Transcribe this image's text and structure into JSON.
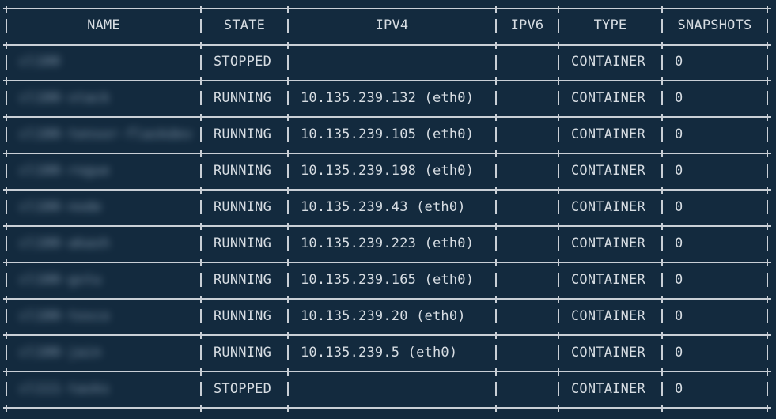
{
  "columns": [
    "NAME",
    "STATE",
    "IPV4",
    "IPV6",
    "TYPE",
    "SNAPSHOTS"
  ],
  "rows": [
    {
      "name": "cl100",
      "state": "STOPPED",
      "ipv4": "",
      "ipv6": "",
      "type": "CONTAINER",
      "snapshots": "0"
    },
    {
      "name": "cl100-stack",
      "state": "RUNNING",
      "ipv4": "10.135.239.132 (eth0)",
      "ipv6": "",
      "type": "CONTAINER",
      "snapshots": "0"
    },
    {
      "name": "cl100-tensor-flaskdev",
      "state": "RUNNING",
      "ipv4": "10.135.239.105 (eth0)",
      "ipv6": "",
      "type": "CONTAINER",
      "snapshots": "0"
    },
    {
      "name": "cl100-rogue",
      "state": "RUNNING",
      "ipv4": "10.135.239.198 (eth0)",
      "ipv6": "",
      "type": "CONTAINER",
      "snapshots": "0"
    },
    {
      "name": "cl100-node",
      "state": "RUNNING",
      "ipv4": "10.135.239.43 (eth0)",
      "ipv6": "",
      "type": "CONTAINER",
      "snapshots": "0"
    },
    {
      "name": "cl100-akash",
      "state": "RUNNING",
      "ipv4": "10.135.239.223 (eth0)",
      "ipv6": "",
      "type": "CONTAINER",
      "snapshots": "0"
    },
    {
      "name": "cl100-gstu",
      "state": "RUNNING",
      "ipv4": "10.135.239.165 (eth0)",
      "ipv6": "",
      "type": "CONTAINER",
      "snapshots": "0"
    },
    {
      "name": "cl100-tosco",
      "state": "RUNNING",
      "ipv4": "10.135.239.20 (eth0)",
      "ipv6": "",
      "type": "CONTAINER",
      "snapshots": "0"
    },
    {
      "name": "cl100-jain",
      "state": "RUNNING",
      "ipv4": "10.135.239.5 (eth0)",
      "ipv6": "",
      "type": "CONTAINER",
      "snapshots": "0"
    },
    {
      "name": "cl111-tasks",
      "state": "STOPPED",
      "ipv4": "",
      "ipv6": "",
      "type": "CONTAINER",
      "snapshots": "0"
    }
  ]
}
